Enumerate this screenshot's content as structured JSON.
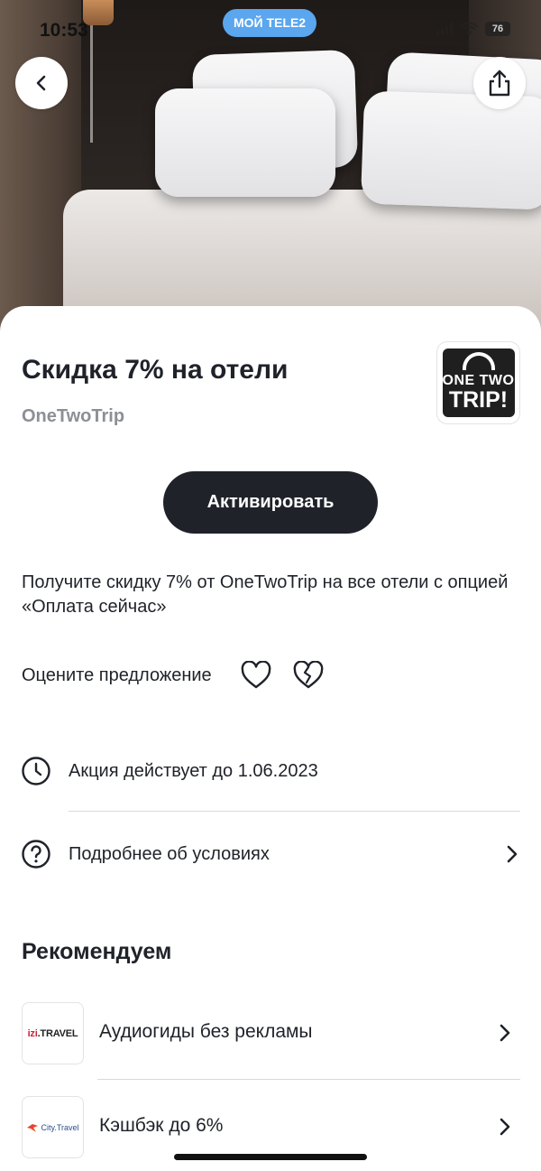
{
  "status_bar": {
    "time": "10:53",
    "carrier_pill": "МОЙ TELE2",
    "battery": "76"
  },
  "header": {
    "back_icon": "chevron-left-icon",
    "share_icon": "share-icon"
  },
  "offer": {
    "title": "Скидка 7% на отели",
    "partner": "OneTwoTrip",
    "logo_line1": "ONE TWO",
    "logo_line2": "TRIP!",
    "activate_label": "Активировать",
    "description": "Получите скидку 7% от OneTwoTrip на все отели с опцией «Оплата сейчас»"
  },
  "rating": {
    "label": "Оцените предложение",
    "like_icon": "heart-icon",
    "dislike_icon": "broken-heart-icon"
  },
  "info_rows": [
    {
      "icon": "clock-icon",
      "text": "Акция действует до 1.06.2023"
    },
    {
      "icon": "question-circle-icon",
      "text": "Подробнее об условиях"
    }
  ],
  "recommend": {
    "title": "Рекомендуем",
    "items": [
      {
        "logo_text_a": "izi",
        "logo_text_b": ".TRAVEL",
        "text": "Аудиогиды без рекламы"
      },
      {
        "logo_text": "City.Travel",
        "text": "Кэшбэк до 6%"
      }
    ]
  },
  "colors": {
    "primary_text": "#1f2229",
    "secondary_text": "#8b8f96",
    "button_bg": "#1f2229",
    "pill_bg": "#5aa6ef"
  }
}
